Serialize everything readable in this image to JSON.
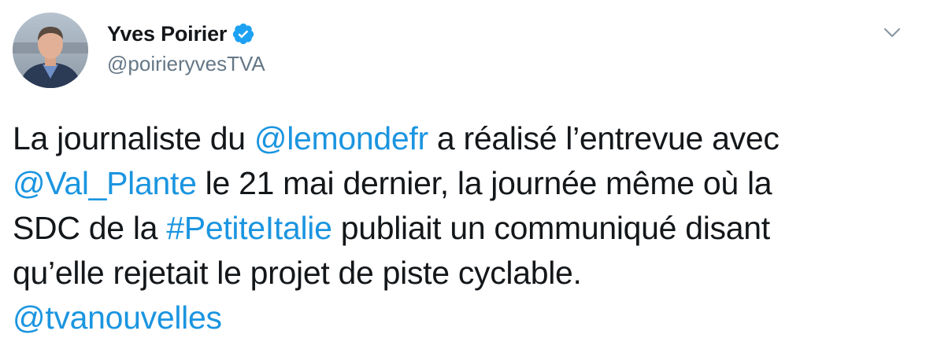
{
  "author": {
    "display_name": "Yves Poirier",
    "handle": "@poirieryvesTVA",
    "verified_icon": "verified-badge-icon",
    "avatar_alt": "profile photo"
  },
  "menu": {
    "caret_icon": "chevron-down-icon"
  },
  "tweet": {
    "lines": [
      [
        {
          "text": "La journaliste du ",
          "link": false
        },
        {
          "text": "@lemondefr",
          "link": true
        },
        {
          "text": " a réalisé l’entrevue avec",
          "link": false
        }
      ],
      [
        {
          "text": "@Val_Plante",
          "link": true
        },
        {
          "text": " le 21 mai dernier, la journée même où la",
          "link": false
        }
      ],
      [
        {
          "text": "SDC de la ",
          "link": false
        },
        {
          "text": "#PetiteItalie",
          "link": true
        },
        {
          "text": " publiait un communiqué disant",
          "link": false
        }
      ],
      [
        {
          "text": "qu’elle rejetait le projet de piste cyclable.",
          "link": false
        }
      ],
      [
        {
          "text": "@tvanouvelles",
          "link": true
        }
      ]
    ]
  },
  "colors": {
    "text": "#14171a",
    "secondary": "#657786",
    "link": "#1b95e0",
    "verified": "#1da1f2"
  }
}
